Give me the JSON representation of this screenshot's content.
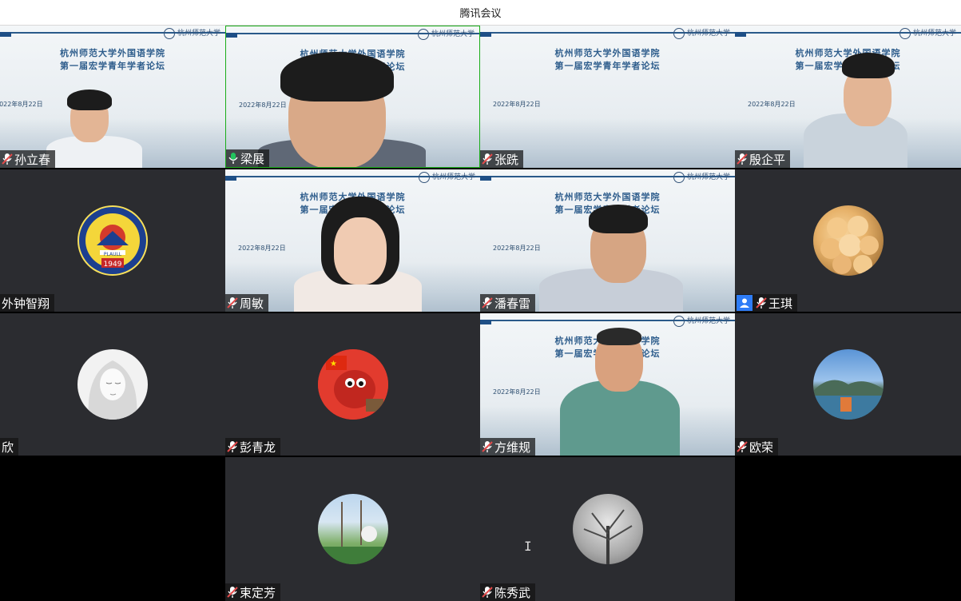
{
  "window": {
    "title": "腾讯会议"
  },
  "slide": {
    "line1": "杭州师范大学外国语学院",
    "line2": "第一届宏学青年学者论坛",
    "date": "2022年8月22日",
    "logo_text": "杭州师范大学"
  },
  "participants": [
    {
      "name": "孙立春",
      "mic": "muted"
    },
    {
      "name": "梁展",
      "mic": "active"
    },
    {
      "name": "张跣",
      "mic": "muted"
    },
    {
      "name": "殷企平",
      "mic": "muted"
    },
    {
      "name": "外钟智翔",
      "mic": "none"
    },
    {
      "name": "周敏",
      "mic": "muted"
    },
    {
      "name": "潘春雷",
      "mic": "muted"
    },
    {
      "name": "王琪",
      "mic": "muted"
    },
    {
      "name": "欣",
      "mic": "none"
    },
    {
      "name": "彭青龙",
      "mic": "muted"
    },
    {
      "name": "方维规",
      "mic": "muted"
    },
    {
      "name": "欧荣",
      "mic": "muted"
    },
    {
      "name": "束定芳",
      "mic": "muted"
    },
    {
      "name": "陈秀武",
      "mic": "muted"
    }
  ],
  "badge": {
    "emblem_year": "1949",
    "emblem_code": "PLAULL"
  },
  "colors": {
    "active_border": "#1aad19",
    "mic_muted": "#e24b4b",
    "mic_active": "#22c55e",
    "user_badge": "#2e7cf6"
  }
}
